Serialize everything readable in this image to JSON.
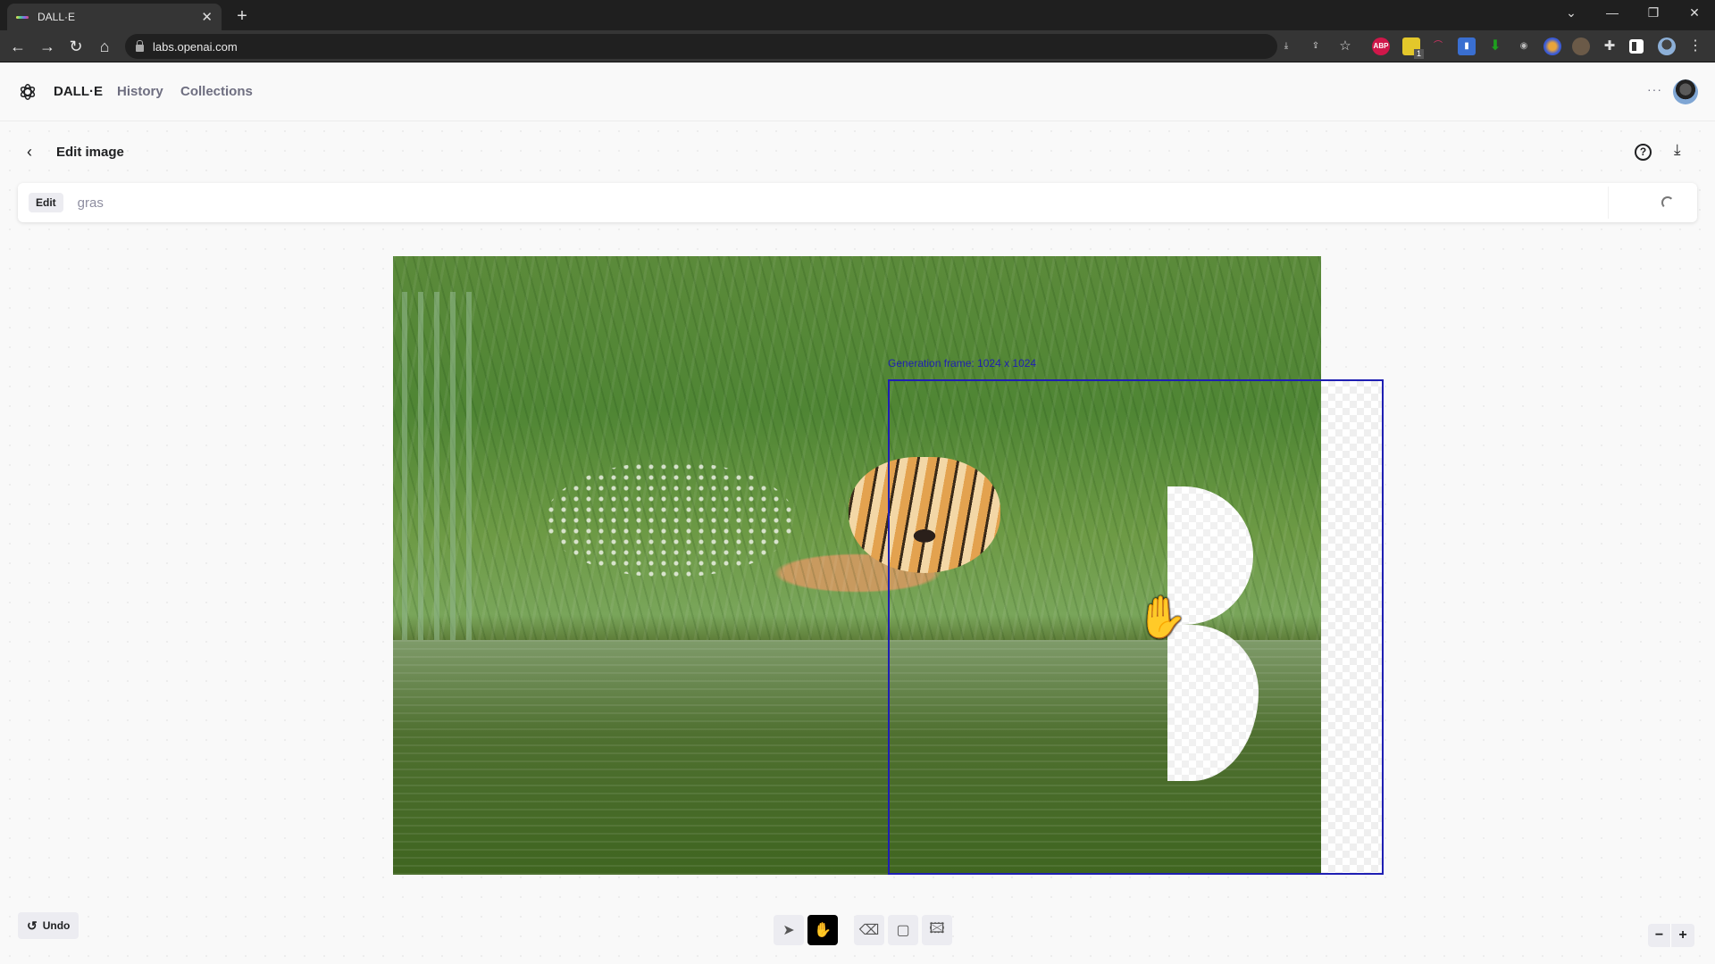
{
  "browser": {
    "tab_title": "DALL·E",
    "url": "labs.openai.com",
    "extension_badge_count": "1"
  },
  "app": {
    "brand": "DALL·E",
    "nav": [
      {
        "label": "History"
      },
      {
        "label": "Collections"
      }
    ],
    "more_label": "···"
  },
  "editor": {
    "title": "Edit image",
    "mode_badge": "Edit",
    "prompt_value": "gras",
    "generation_frame_label": "Generation frame: 1024 x 1024",
    "undo_label": "Undo",
    "tools": [
      {
        "name": "select",
        "active": false
      },
      {
        "name": "pan",
        "active": true
      },
      {
        "name": "eraser",
        "active": false
      },
      {
        "name": "add-generation-frame",
        "active": false
      },
      {
        "name": "upload-image",
        "active": false
      }
    ],
    "zoom_out": "−",
    "zoom_in": "+"
  },
  "colors": {
    "frame": "#1f1fb3",
    "active_tool": "#000000"
  }
}
